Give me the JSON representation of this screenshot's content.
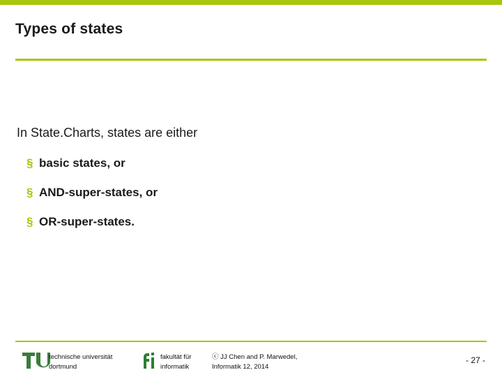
{
  "theme": {
    "accent": "#a8c60a",
    "text": "#1a1a1a",
    "background": "#ffffff"
  },
  "slide": {
    "title": "Types of states",
    "lead": "In State.Charts, states are either",
    "bullets": [
      {
        "marker": "§",
        "text": "basic states, or"
      },
      {
        "marker": "§",
        "text": "AND-super-states, or"
      },
      {
        "marker": "§",
        "text": "OR-super-states."
      }
    ]
  },
  "footer": {
    "university": "technische universität\ndortmund",
    "faculty": "fakultät für\ninformatik",
    "copyright": "ⓒ JJ Chen and  P. Marwedel,\nInformatik 12,  2014",
    "page": "-  27 -"
  }
}
